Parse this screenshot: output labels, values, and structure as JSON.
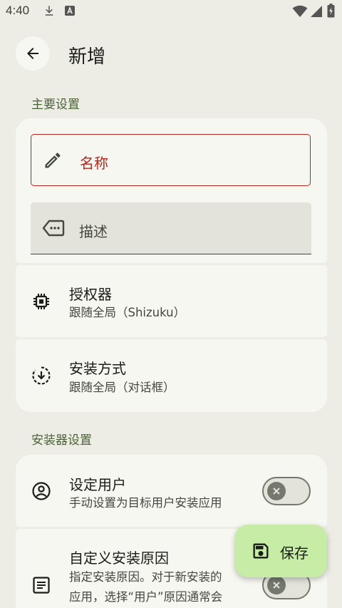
{
  "status_bar": {
    "time": "4:40"
  },
  "header": {
    "title": "新增"
  },
  "sections": {
    "main": "主要设置",
    "installer": "安装器设置"
  },
  "fields": {
    "name_placeholder": "名称",
    "desc_placeholder": "描述"
  },
  "rows": {
    "authorizer": {
      "title": "授权器",
      "subtitle": "跟随全局（Shizuku）"
    },
    "install_method": {
      "title": "安装方式",
      "subtitle": "跟随全局（对话框）"
    },
    "set_user": {
      "title": "设定用户",
      "subtitle": "手动设置为目标用户安装应用"
    },
    "custom_reason": {
      "title": "自定义安装原因",
      "subtitle_line1": "指定安装原因。对于新安装的",
      "subtitle_line2": "应用，选择“用户”原因通常会"
    }
  },
  "fab": {
    "label": "保存"
  },
  "colors": {
    "accent_green": "#4a6336",
    "error_red": "#b3261e",
    "fab_bg": "#c6eca6",
    "surface": "#f7f7f1",
    "background": "#edede6"
  }
}
